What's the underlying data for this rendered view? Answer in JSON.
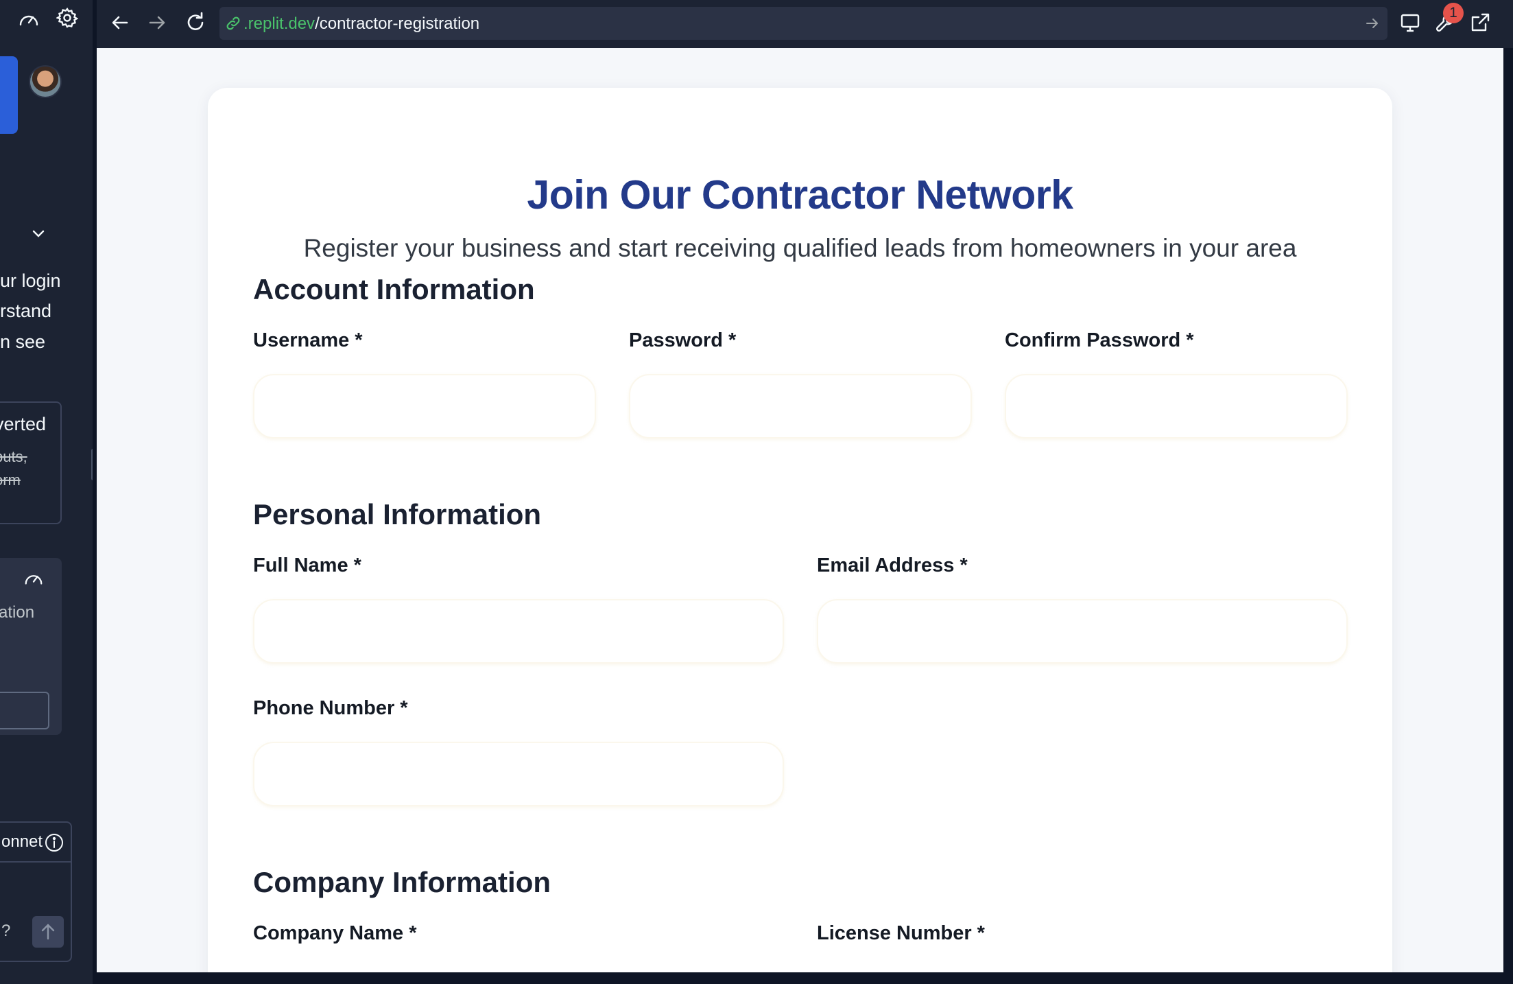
{
  "sidebar": {
    "text_line1": "ur login",
    "text_line2": "rstand",
    "text_line3": "n see",
    "card1_title": "verted",
    "card1_strike1": "puts,",
    "card1_strike2": "orm",
    "card2_text": "ration",
    "model_label": "onnet",
    "input_fragment": "?"
  },
  "browser": {
    "url_domain": ".replit.dev",
    "url_path": "/contractor-registration",
    "tools_badge": "1"
  },
  "form": {
    "title": "Join Our Contractor Network",
    "subtitle": "Register your business and start receiving qualified leads from homeowners in your area",
    "sections": {
      "account": "Account Information",
      "personal": "Personal Information",
      "company": "Company Information"
    },
    "labels": {
      "username": "Username *",
      "password": "Password *",
      "confirm_password": "Confirm Password *",
      "full_name": "Full Name *",
      "email": "Email Address *",
      "phone": "Phone Number *",
      "company_name": "Company Name *",
      "license_number": "License Number *"
    }
  },
  "colors": {
    "title": "#233a8a",
    "url_domain": "#4ac26b",
    "badge": "#e5534b"
  }
}
